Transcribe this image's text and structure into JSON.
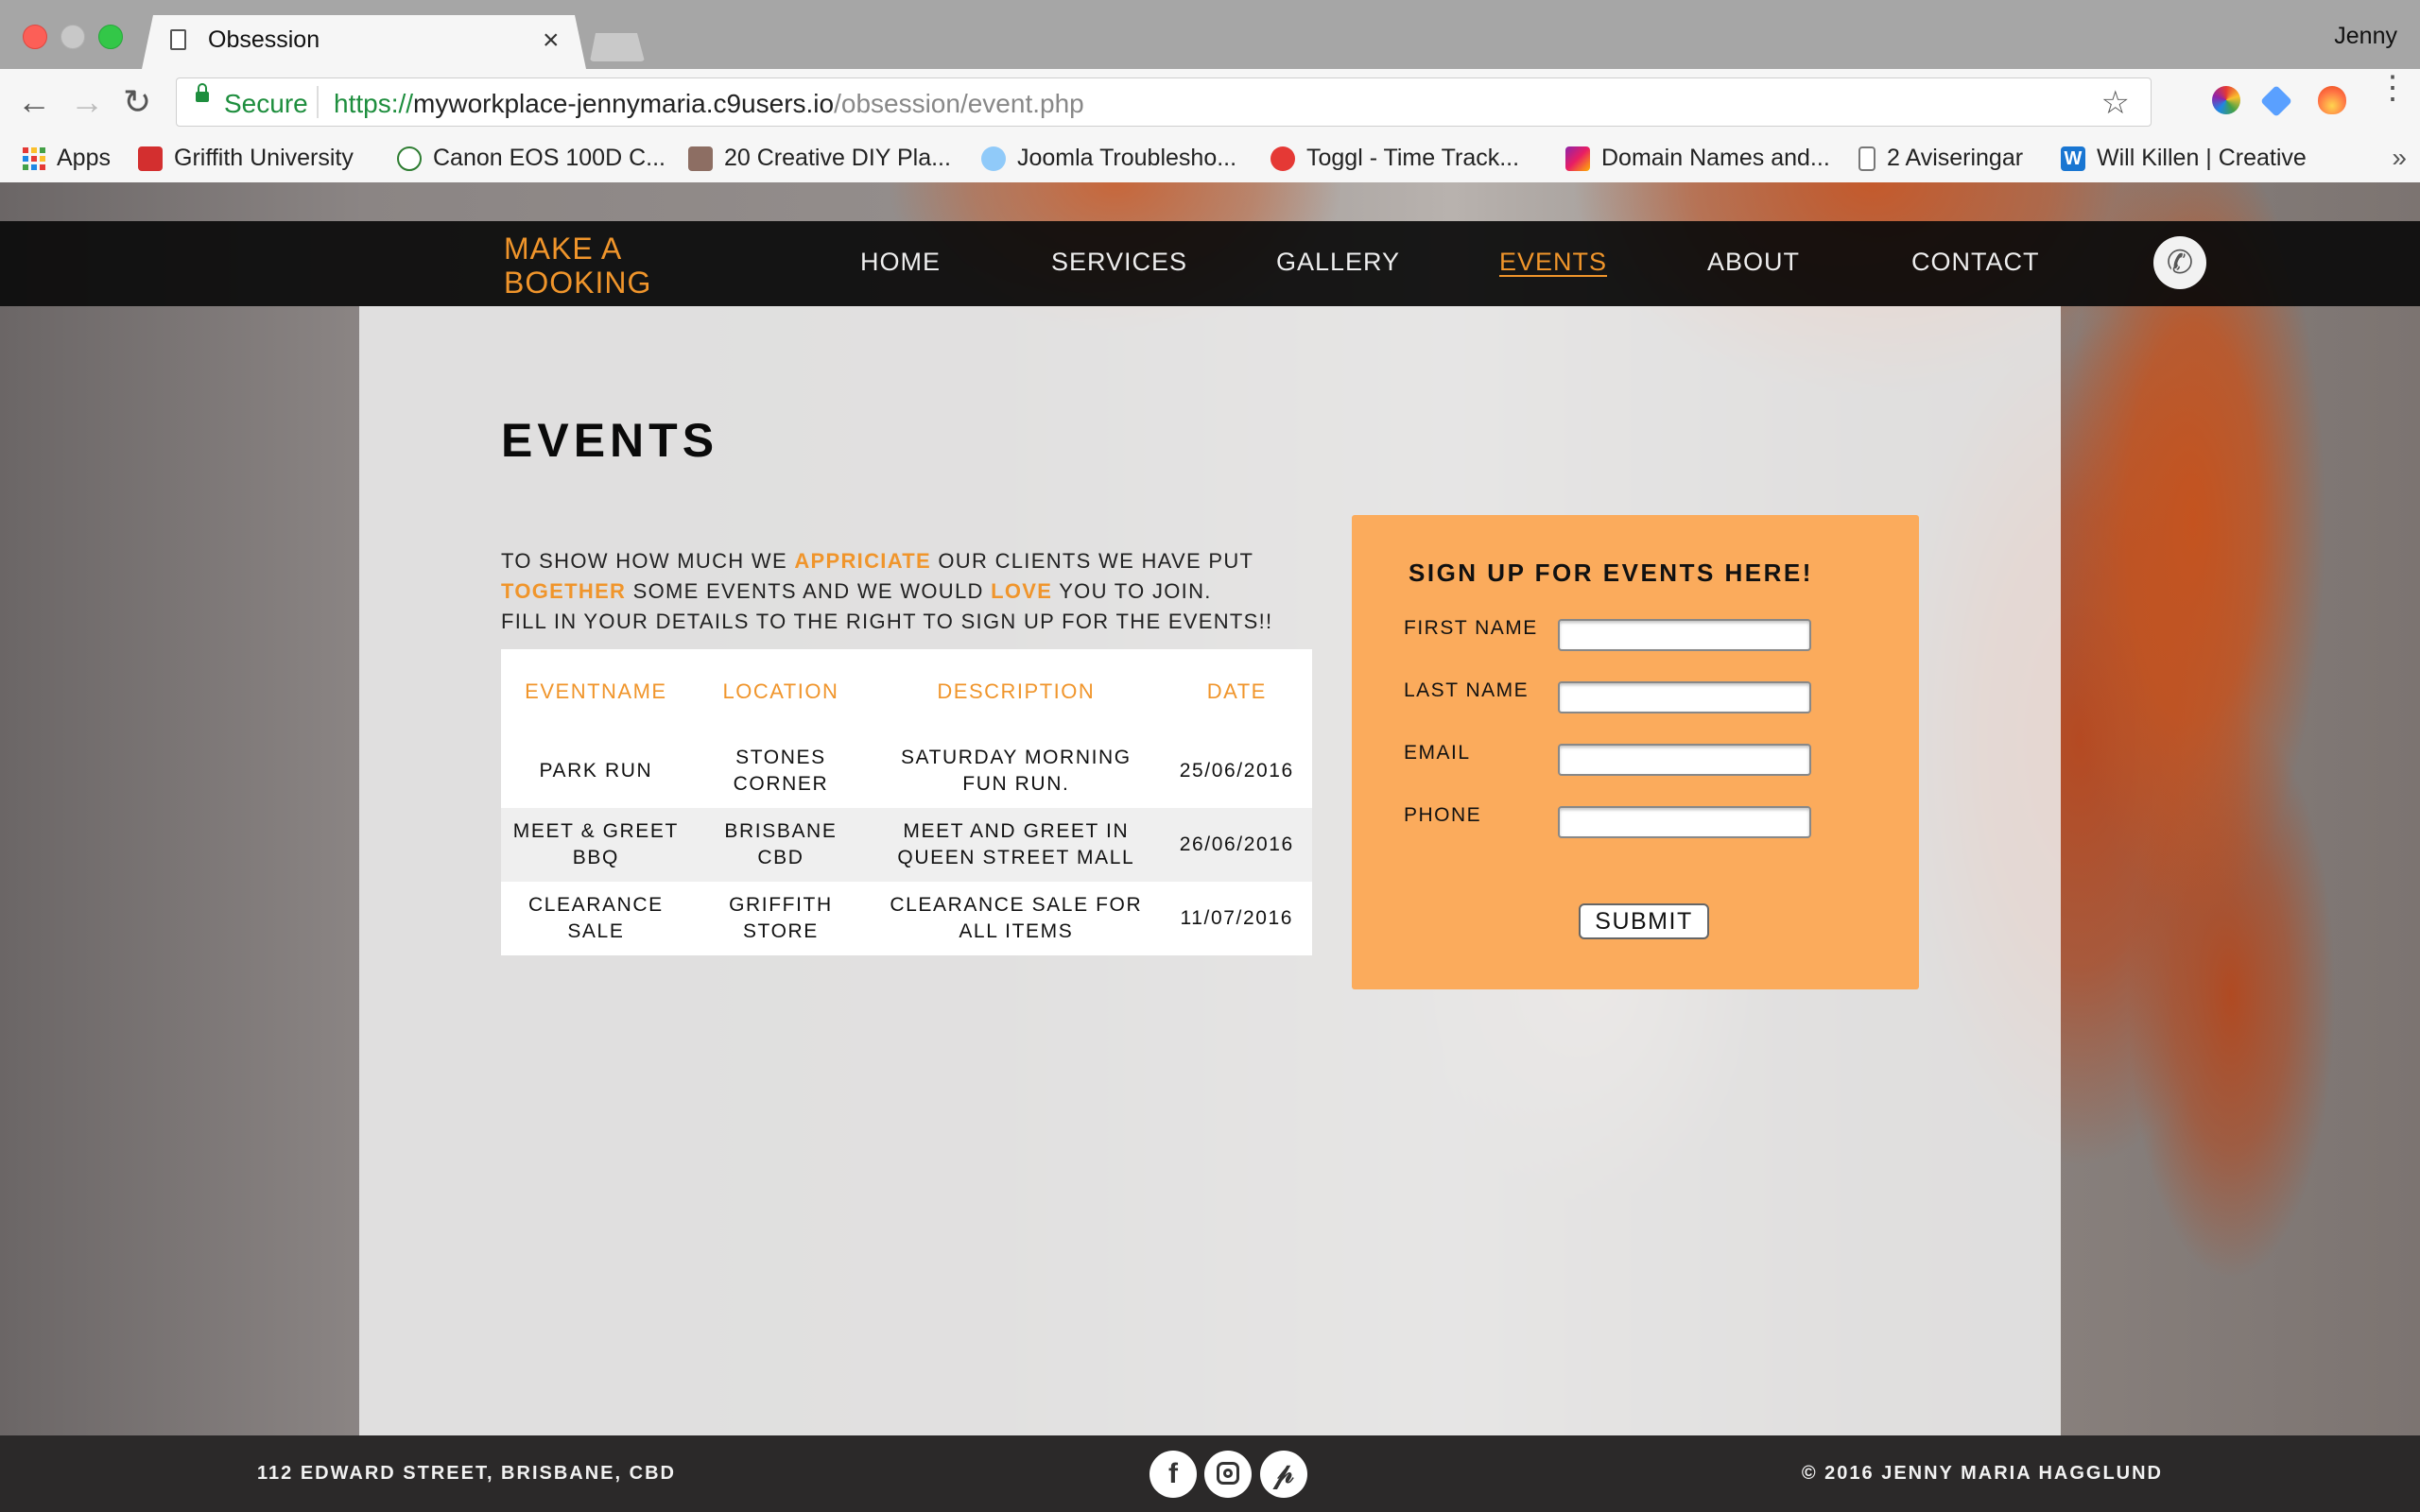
{
  "browser": {
    "tab_title": "Obsession",
    "tab_close": "×",
    "profile_name": "Jenny",
    "secure_label": "Secure",
    "url_scheme": "https://",
    "url_host": "myworkplace-jennymaria.c9users.io",
    "url_path": "/obsession/event.php",
    "bookmarks": [
      {
        "label": "Apps",
        "icon": "apps-grid-icon"
      },
      {
        "label": "Griffith University",
        "icon": "griffith-icon",
        "color": "#d32f2f"
      },
      {
        "label": "Canon EOS 100D C...",
        "icon": "canon-icon",
        "color": "#2e7d32"
      },
      {
        "label": "20 Creative DIY Pla...",
        "icon": "diy-icon",
        "color": "#8d6e63"
      },
      {
        "label": "Joomla Troublesho...",
        "icon": "joomla-icon",
        "color": "#1e88e5"
      },
      {
        "label": "Toggl - Time Track...",
        "icon": "toggl-icon",
        "color": "#e53935"
      },
      {
        "label": "Domain Names and...",
        "icon": "domain-icon",
        "color": "#8e24aa"
      },
      {
        "label": "2 Aviseringar",
        "icon": "doc-icon",
        "color": "#777777"
      },
      {
        "label": "Will Killen | Creative",
        "icon": "w-icon",
        "color": "#1976d2"
      }
    ],
    "bookmarks_more": "»"
  },
  "site": {
    "brand_line1": "MAKE A",
    "brand_line2": "BOOKING",
    "nav": [
      "HOME",
      "SERVICES",
      "GALLERY",
      "EVENTS",
      "ABOUT",
      "CONTACT"
    ],
    "active_nav": "EVENTS",
    "accent_color": "#f0952b"
  },
  "main": {
    "heading": "EVENTS",
    "intro": {
      "l1a": "TO SHOW HOW MUCH WE ",
      "l1b": "APPRICIATE",
      "l1c": " OUR CLIENTS WE HAVE PUT",
      "l2a": "TOGETHER",
      "l2b": " SOME EVENTS AND WE WOULD ",
      "l2c": "LOVE",
      "l2d": " YOU TO JOIN.",
      "l3": "FILL IN YOUR DETAILS TO THE RIGHT TO SIGN UP FOR THE EVENTS!!"
    },
    "table": {
      "headers": [
        "EVENTNAME",
        "LOCATION",
        "DESCRIPTION",
        "DATE"
      ],
      "rows": [
        [
          "PARK RUN",
          "STONES CORNER",
          "SATURDAY MORNING FUN RUN.",
          "25/06/2016"
        ],
        [
          "MEET & GREET BBQ",
          "BRISBANE CBD",
          "MEET AND GREET IN QUEEN STREET MALL",
          "26/06/2016"
        ],
        [
          "CLEARANCE SALE",
          "GRIFFITH STORE",
          "CLEARANCE SALE FOR ALL ITEMS",
          "11/07/2016"
        ]
      ]
    },
    "signup": {
      "title": "SIGN UP FOR EVENTS HERE!",
      "fields": [
        {
          "label": "FIRST NAME",
          "value": ""
        },
        {
          "label": "LAST NAME",
          "value": ""
        },
        {
          "label": "EMAIL",
          "value": ""
        },
        {
          "label": "PHONE",
          "value": ""
        }
      ],
      "submit_label": "SUBMIT",
      "box_color": "#fbab5c"
    }
  },
  "footer": {
    "address": "112 EDWARD STREET, BRISBANE, CBD",
    "copyright": "© 2016 JENNY MARIA HAGGLUND",
    "social": [
      "facebook-icon",
      "instagram-icon",
      "pinterest-icon"
    ]
  }
}
